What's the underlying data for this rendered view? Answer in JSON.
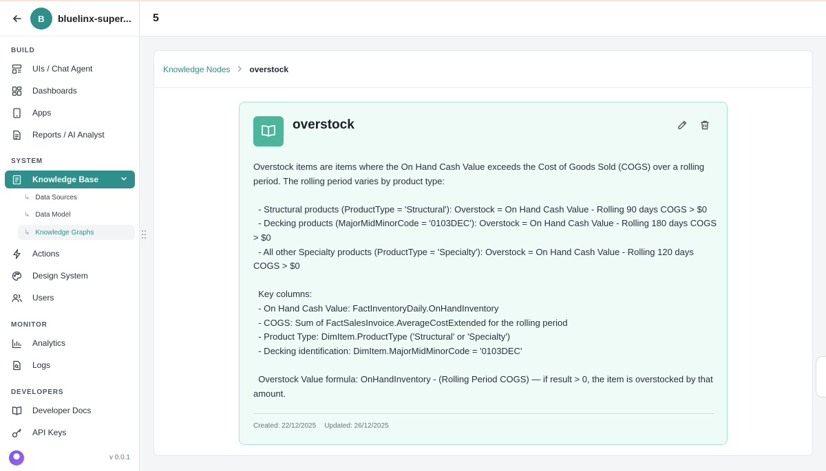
{
  "org": {
    "initial": "B",
    "name": "bluelinx-super..."
  },
  "header": {
    "title": "5"
  },
  "sidebar": {
    "sections": {
      "build": "BUILD",
      "system": "SYSTEM",
      "monitor": "MONITOR",
      "developers": "DEVELOPERS"
    },
    "items": {
      "uis": "UIs / Chat Agent",
      "dashboards": "Dashboards",
      "apps": "Apps",
      "reports": "Reports / AI Analyst",
      "knowledge_base": "Knowledge Base",
      "actions": "Actions",
      "design_system": "Design System",
      "users": "Users",
      "analytics": "Analytics",
      "logs": "Logs",
      "developer_docs": "Developer Docs",
      "api_keys": "API Keys"
    },
    "subitems": {
      "data_sources": "Data Sources",
      "data_model": "Data Model",
      "knowledge_graphs": "Knowledge Graphs"
    },
    "version": "v 0.0.1"
  },
  "breadcrumb": {
    "parent": "Knowledge Nodes",
    "current": "overstock"
  },
  "node": {
    "title": "overstock",
    "body": "Overstock items are items where the On Hand Cash Value exceeds the Cost of Goods Sold (COGS) over a rolling period. The rolling period varies by product type:\n\n  - Structural products (ProductType = 'Structural'): Overstock = On Hand Cash Value - Rolling 90 days COGS > $0\n  - Decking products (MajorMidMinorCode = '0103DEC'): Overstock = On Hand Cash Value - Rolling 180 days COGS > $0\n  - All other Specialty products (ProductType = 'Specialty'): Overstock = On Hand Cash Value - Rolling 120 days COGS > $0\n\n  Key columns:\n  - On Hand Cash Value: FactInventoryDaily.OnHandInventory\n  - COGS: Sum of FactSalesInvoice.AverageCostExtended for the rolling period\n  - Product Type: DimItem.ProductType ('Structural' or 'Specialty')\n  - Decking identification: DimItem.MajorMidMinorCode = '0103DEC'\n\n  Overstock Value formula: OnHandInventory - (Rolling Period COGS) — if result > 0, the item is overstocked by that amount.",
    "created": "Created: 22/12/2025",
    "updated": "Updated: 26/12/2025"
  },
  "colors": {
    "accent": "#2f8f8a",
    "card_bg": "#effbf7",
    "card_border": "#a9e6d2",
    "icon_bg": "#4bb69a"
  }
}
